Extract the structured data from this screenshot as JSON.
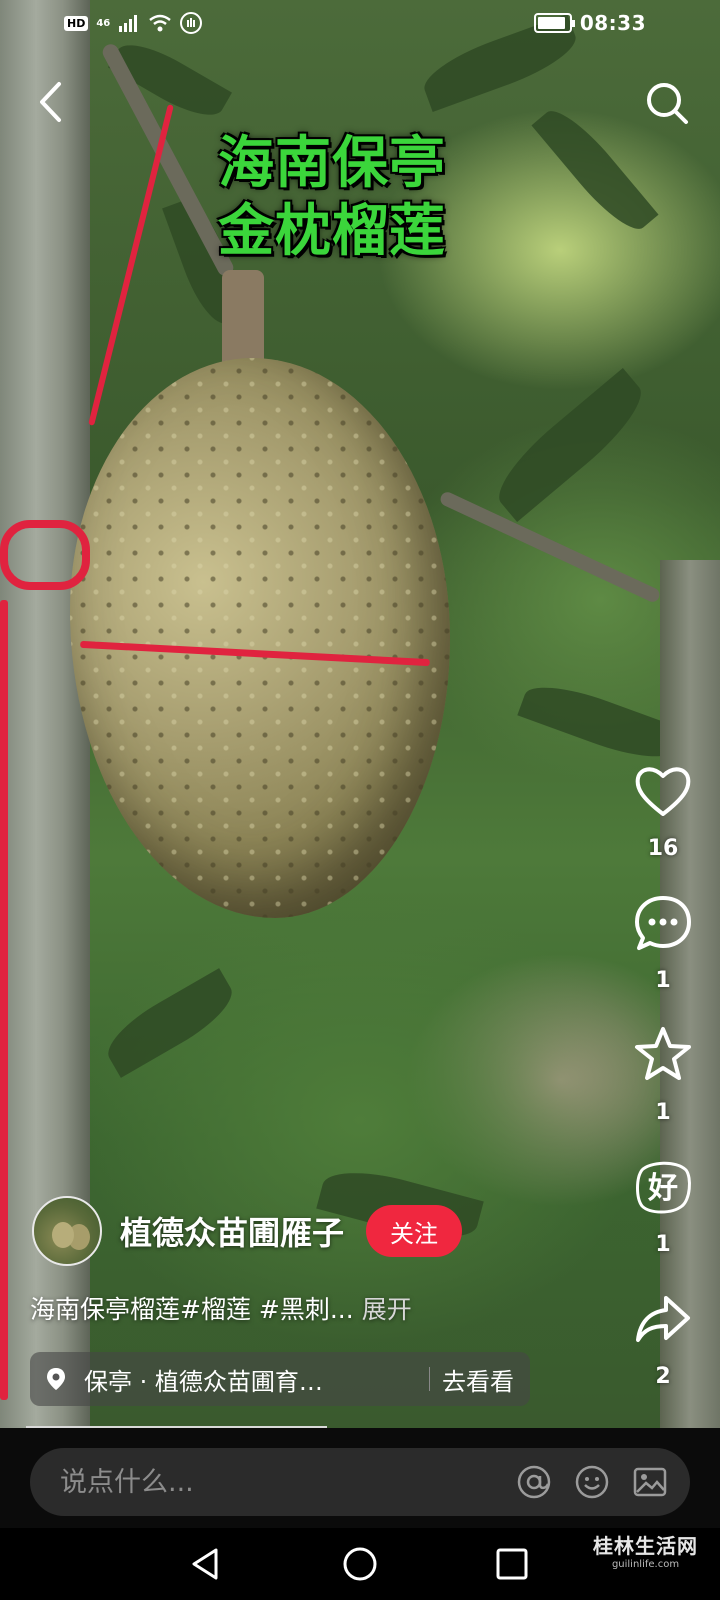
{
  "status_bar": {
    "hd": "HD",
    "network": "46",
    "time": "08:33",
    "battery_level": 0.9
  },
  "video": {
    "overlay_title_line1": "海南保亭",
    "overlay_title_line2": "金枕榴莲"
  },
  "actions": {
    "like": {
      "icon": "heart-icon",
      "count": "16"
    },
    "comment": {
      "icon": "comment-bubble-icon",
      "count": "1"
    },
    "favorite": {
      "icon": "star-icon",
      "count": "1"
    },
    "rate": {
      "icon": "good-stamp-icon",
      "label": "好",
      "count": "1"
    },
    "share": {
      "icon": "share-arrow-icon",
      "count": "2"
    }
  },
  "author": {
    "name": "植德众苗圃雁子",
    "follow_label": "关注"
  },
  "description": {
    "text": "海南保亭榴莲#榴莲 #黑刺...",
    "expand_label": "展开"
  },
  "location": {
    "place": "保亭 · 植德众苗圃育…",
    "action_label": "去看看"
  },
  "playback_progress": 0.45,
  "comment_bar": {
    "placeholder": "说点什么..."
  },
  "watermark": {
    "main": "桂林生活网",
    "sub": "guilinlife.com"
  },
  "colors": {
    "accent": "#f0273f",
    "caption_green": "#3bd63b"
  }
}
